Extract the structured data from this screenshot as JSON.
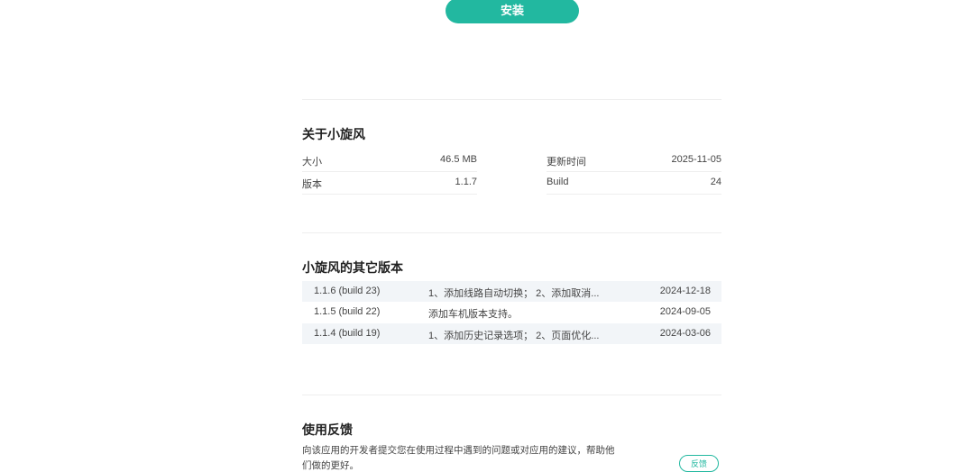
{
  "install": {
    "label": "安装"
  },
  "about": {
    "title": "关于小旋风",
    "size_label": "大小",
    "size_value": "46.5 MB",
    "updated_label": "更新时间",
    "updated_value": "2025-11-05",
    "version_label": "版本",
    "version_value": "1.1.7",
    "build_label": "Build",
    "build_value": "24"
  },
  "other_versions": {
    "title": "小旋风的其它版本",
    "rows": [
      {
        "version": "1.1.6 (build 23)",
        "notes": "1、添加线路自动切换； 2、添加取消...",
        "date": "2024-12-18"
      },
      {
        "version": "1.1.5 (build 22)",
        "notes": "添加车机版本支持。",
        "date": "2024-09-05"
      },
      {
        "version": "1.1.4 (build 19)",
        "notes": "1、添加历史记录选项； 2、页面优化...",
        "date": "2024-03-06"
      }
    ]
  },
  "feedback": {
    "title": "使用反馈",
    "description": "向该应用的开发者提交您在使用过程中遇到的问题或对应用的建议，帮助他们做的更好。",
    "button_label": "反馈"
  },
  "colors": {
    "accent": "#22b8a0",
    "row_stripe": "#f2f5f8",
    "divider": "#eeeeee"
  }
}
